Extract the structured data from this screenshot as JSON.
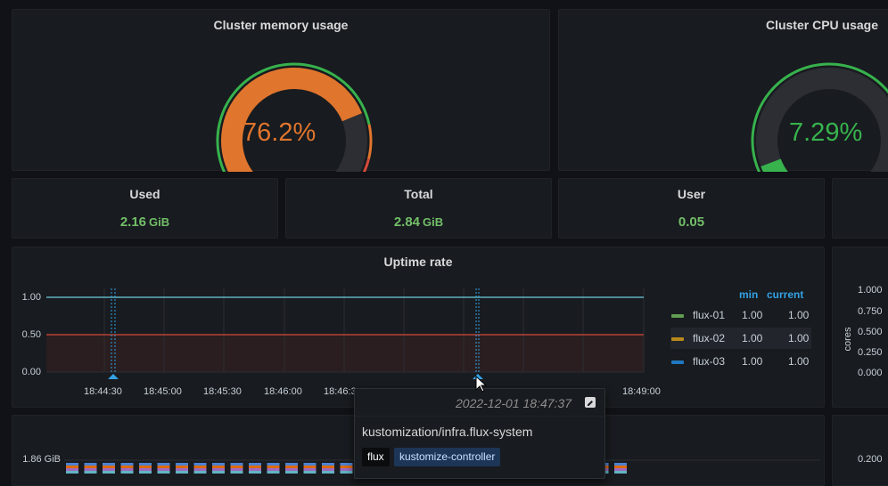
{
  "memory_gauge": {
    "title": "Cluster memory usage",
    "value": "76.2%",
    "percent": 76.2,
    "color": "#e0752d"
  },
  "cpu_gauge": {
    "title": "Cluster CPU usage",
    "value": "7.29%",
    "percent": 7.29,
    "color": "#37b24d"
  },
  "stats": [
    {
      "title": "Used",
      "value": "2.16",
      "unit": "GiB"
    },
    {
      "title": "Total",
      "value": "2.84",
      "unit": "GiB"
    },
    {
      "title": "User",
      "value": "0.05",
      "unit": ""
    }
  ],
  "uptime": {
    "title": "Uptime rate",
    "legend_headers": {
      "min": "min",
      "current": "current"
    },
    "legend": [
      {
        "name": "flux-01",
        "min": "1.00",
        "current": "1.00",
        "color": "#629e51"
      },
      {
        "name": "flux-02",
        "min": "1.00",
        "current": "1.00",
        "color": "#b7891b"
      },
      {
        "name": "flux-03",
        "min": "1.00",
        "current": "1.00",
        "color": "#1f78c1"
      }
    ]
  },
  "chart_data": {
    "type": "line",
    "title": "Uptime rate",
    "y_ticks": [
      "1.00",
      "0.50",
      "0.00"
    ],
    "x_ticks": [
      "18:44:30",
      "18:45:00",
      "18:45:30",
      "18:46:00",
      "18:46:3",
      "18:49:00"
    ],
    "ylim": [
      0,
      1
    ],
    "series": [
      {
        "name": "flux-01",
        "values": [
          1.0
        ]
      },
      {
        "name": "flux-02",
        "values": [
          1.0
        ]
      },
      {
        "name": "flux-03",
        "values": [
          1.0
        ]
      }
    ],
    "threshold": 0.5
  },
  "right_axis": {
    "label": "cores",
    "ticks": [
      "1.000",
      "0.750",
      "0.500",
      "0.250",
      "0.000"
    ],
    "bottom_tick": "0.200"
  },
  "memory_axis": {
    "tick": "1.86 GiB"
  },
  "tooltip": {
    "timestamp": "2022-12-01 18:47:37",
    "text": "kustomization/infra.flux-system",
    "tags": [
      "flux",
      "kustomize-controller"
    ]
  }
}
